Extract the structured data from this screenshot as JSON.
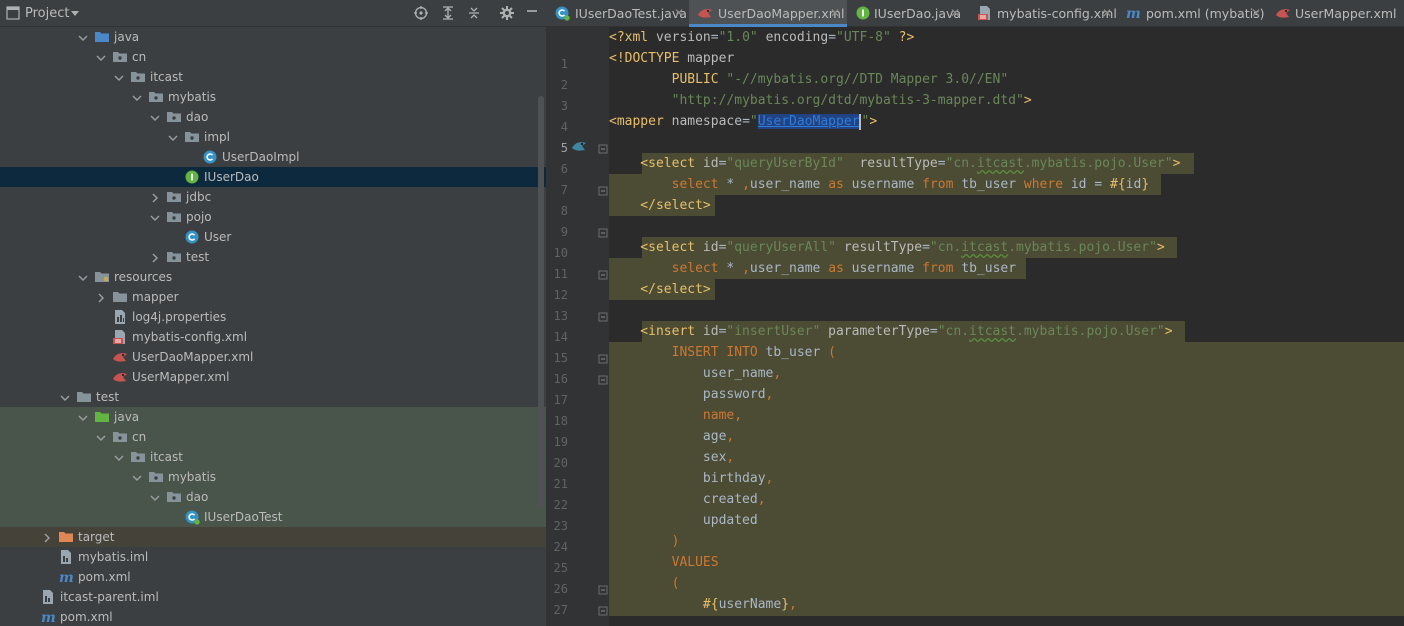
{
  "project_panel": {
    "title": "Project",
    "tree": [
      {
        "label": "java",
        "icon": "folder-source-icon"
      },
      {
        "label": "cn",
        "icon": "package-icon"
      },
      {
        "label": "itcast",
        "icon": "package-icon"
      },
      {
        "label": "mybatis",
        "icon": "package-icon"
      },
      {
        "label": "dao",
        "icon": "package-icon"
      },
      {
        "label": "impl",
        "icon": "package-icon"
      },
      {
        "label": "UserDaoImpl",
        "icon": "class-icon"
      },
      {
        "label": "IUserDao",
        "icon": "interface-icon"
      },
      {
        "label": "jdbc",
        "icon": "package-icon"
      },
      {
        "label": "pojo",
        "icon": "package-icon"
      },
      {
        "label": "User",
        "icon": "class-icon"
      },
      {
        "label": "test",
        "icon": "package-icon"
      },
      {
        "label": "resources",
        "icon": "folder-resources-icon"
      },
      {
        "label": "mapper",
        "icon": "folder-icon"
      },
      {
        "label": "log4j.properties",
        "icon": "properties-file-icon"
      },
      {
        "label": "mybatis-config.xml",
        "icon": "config-xml-icon"
      },
      {
        "label": "UserDaoMapper.xml",
        "icon": "mybatis-xml-icon"
      },
      {
        "label": "UserMapper.xml",
        "icon": "mybatis-xml-icon"
      },
      {
        "label": "test",
        "icon": "folder-icon"
      },
      {
        "label": "java",
        "icon": "folder-test-icon"
      },
      {
        "label": "cn",
        "icon": "package-icon"
      },
      {
        "label": "itcast",
        "icon": "package-icon"
      },
      {
        "label": "mybatis",
        "icon": "package-icon"
      },
      {
        "label": "dao",
        "icon": "package-icon"
      },
      {
        "label": "IUserDaoTest",
        "icon": "test-class-icon"
      },
      {
        "label": "target",
        "icon": "folder-excluded-icon"
      },
      {
        "label": "mybatis.iml",
        "icon": "iml-file-icon"
      },
      {
        "label": "pom.xml",
        "icon": "maven-icon"
      },
      {
        "label": "itcast-parent.iml",
        "icon": "iml-file-icon"
      },
      {
        "label": "pom.xml",
        "icon": "maven-icon"
      }
    ]
  },
  "tabs": [
    {
      "label": "IUserDaoTest.java",
      "icon": "test-class-icon",
      "active": false
    },
    {
      "label": "UserDaoMapper.xml",
      "icon": "mybatis-xml-icon",
      "active": true
    },
    {
      "label": "IUserDao.java",
      "icon": "interface-icon",
      "active": false
    },
    {
      "label": "mybatis-config.xml",
      "icon": "config-xml-icon",
      "active": false
    },
    {
      "label": "pom.xml (mybatis)",
      "icon": "maven-icon",
      "active": false
    },
    {
      "label": "UserMapper.xml",
      "icon": "mybatis-xml-icon",
      "active": false
    }
  ],
  "editor": {
    "current_line": 5,
    "code": {
      "l1": {
        "a": "<?xml ",
        "b": "version",
        "c": "=",
        "d": "\"1.0\"",
        "e": " ",
        "f": "encoding",
        "g": "=",
        "h": "\"UTF-8\"",
        "i": " ?>"
      },
      "l2": {
        "a": "<!DOCTYPE ",
        "b": "mapper"
      },
      "l3": {
        "a": "        PUBLIC ",
        "b": "\"-//mybatis.org//DTD Mapper 3.0//EN\""
      },
      "l4": {
        "a": "        ",
        "b": "\"http://mybatis.org/dtd/mybatis-3-mapper.dtd\"",
        "c": ">"
      },
      "l5": {
        "a": "<mapper ",
        "b": "namespace",
        "c": "=",
        "d": "\"",
        "e": "UserDaoMapper",
        "f": "\"",
        "g": ">"
      },
      "l7": {
        "a": "    <select ",
        "b": "id",
        "c": "=",
        "d": "\"queryUserById\"",
        "e": "  ",
        "f": "resultType",
        "g": "=",
        "h": "\"cn.",
        "i": "itcast",
        "j": ".mybatis.pojo.User\"",
        "k": ">"
      },
      "l8": {
        "a": "        ",
        "b": "select",
        "c": " * ",
        "d": ",",
        "e": "user_name ",
        "f": "as",
        "g": " username ",
        "h": "from",
        "i": " tb_user ",
        "j": "where",
        "k": " id = ",
        "l": "#{",
        "m": "id",
        "n": "}"
      },
      "l9": {
        "a": "    </select>"
      },
      "l11": {
        "a": "    <select ",
        "b": "id",
        "c": "=",
        "d": "\"queryUserAll\"",
        "e": " ",
        "f": "resultType",
        "g": "=",
        "h": "\"cn.",
        "i": "itcast",
        "j": ".mybatis.pojo.User\"",
        "k": ">"
      },
      "l12": {
        "a": "        ",
        "b": "select",
        "c": " * ",
        "d": ",",
        "e": "user_name ",
        "f": "as",
        "g": " username ",
        "h": "from",
        "i": " tb_user"
      },
      "l13": {
        "a": "    </select>"
      },
      "l15": {
        "a": "    <insert ",
        "b": "id",
        "c": "=",
        "d": "\"insertUser\"",
        "e": " ",
        "f": "parameterType",
        "g": "=",
        "h": "\"cn.",
        "i": "itcast",
        "j": ".mybatis.pojo.User\"",
        "k": ">"
      },
      "l16": {
        "a": "        ",
        "b": "INSERT INTO",
        "c": " tb_user ",
        "d": "("
      },
      "l17": {
        "a": "            user_name",
        "b": ","
      },
      "l18": {
        "a": "            password",
        "b": ","
      },
      "l19": {
        "a": "            ",
        "b": "name",
        "c": ","
      },
      "l20": {
        "a": "            age",
        "b": ","
      },
      "l21": {
        "a": "            sex",
        "b": ","
      },
      "l22": {
        "a": "            birthday",
        "b": ","
      },
      "l23": {
        "a": "            created",
        "b": ","
      },
      "l24": {
        "a": "            updated"
      },
      "l25": {
        "a": "        ",
        "b": ")"
      },
      "l26": {
        "a": "        ",
        "b": "VALUES"
      },
      "l27": {
        "a": "        ",
        "b": "("
      },
      "l28": {
        "a": "            ",
        "b": "#{",
        "c": "userName",
        "d": "}",
        "e": ","
      }
    }
  },
  "colors": {
    "accent": "#4a88c7",
    "selection": "#0d293e",
    "injected_sql_bg": "#4c4b34",
    "tag": "#e8bf6a",
    "string": "#6a8759",
    "keyword": "#cc7832"
  }
}
